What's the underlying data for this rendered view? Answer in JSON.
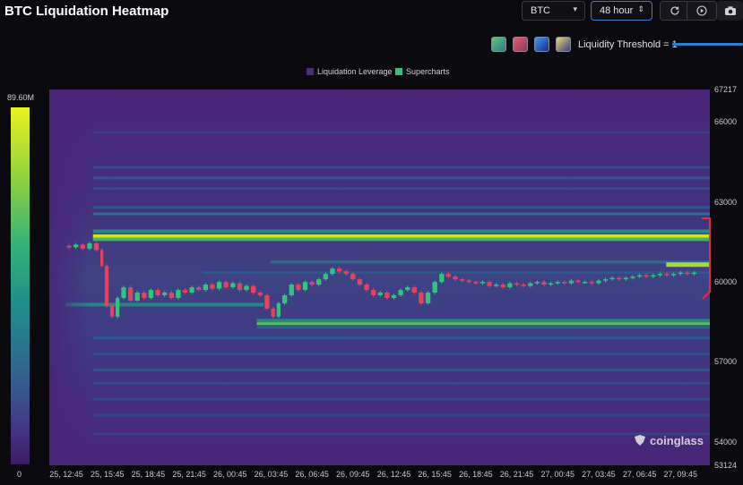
{
  "header": {
    "title": "BTC Liquidation Heatmap",
    "coin_select": "BTC",
    "range_select": "48 hour",
    "threshold_label": "Liquidity Threshold = 1"
  },
  "icons": [
    "refresh-icon",
    "play-icon",
    "camera-icon",
    "chevron-down-icon",
    "up-down-icon"
  ],
  "swatches": [
    {
      "name": "green-theme",
      "from": "#5ac878",
      "to": "#2a7a8a"
    },
    {
      "name": "red-theme",
      "from": "#e06070",
      "to": "#8a3a5a"
    },
    {
      "name": "blue-theme",
      "from": "#3a9af0",
      "to": "#1a2a8a"
    },
    {
      "name": "yellow-theme",
      "from": "#e8d870",
      "to": "#3a3a8a"
    }
  ],
  "colors": {
    "heat_low": "#46227a",
    "heat_mid": "#2a8a8a",
    "heat_high": "#e9f21f",
    "candle_up": "#2fc57b",
    "candle_down": "#e8415d",
    "accent_blue": "#2f7fd0",
    "annotation_red": "#e0303a"
  },
  "colorbar": {
    "max_label": "89.60M",
    "min_label": "0"
  },
  "watermark": "coinglass",
  "chart_data": {
    "type": "heatmap",
    "title": "BTC Liquidation Heatmap",
    "legend": [
      "Liquidation Leverage",
      "Supercharts"
    ],
    "legend_colors": [
      "#4a2a7a",
      "#2fc57b"
    ],
    "legend_placement": "top-center",
    "colorbar_range": [
      0,
      89.6
    ],
    "colorbar_unit": "M",
    "ylim": [
      53124,
      67217
    ],
    "y_ticks": [
      67217,
      66000,
      63000,
      60000,
      57000,
      54000,
      53124
    ],
    "x_ticks": [
      "25, 12:45",
      "25, 15:45",
      "25, 18:45",
      "25, 21:45",
      "26, 00:45",
      "26, 03:45",
      "26, 06:45",
      "26, 09:45",
      "26, 12:45",
      "26, 15:45",
      "26, 18:45",
      "26, 21:45",
      "27, 00:45",
      "27, 03:45",
      "27, 06:45",
      "27, 09:45"
    ],
    "x_tick_hours": [
      0,
      3,
      6,
      9,
      12,
      15,
      18,
      21,
      24,
      27,
      30,
      33,
      36,
      39,
      42,
      45
    ],
    "x_range_hours": [
      -1.2,
      47.2
    ],
    "grid": false,
    "liquidity_bands": [
      {
        "price": 61700,
        "start": 2.0,
        "intensity": 0.97
      },
      {
        "price": 61600,
        "start": 2.0,
        "intensity": 0.7
      },
      {
        "price": 61900,
        "start": 2.0,
        "intensity": 0.55
      },
      {
        "price": 60750,
        "start": 15.0,
        "intensity": 0.45
      },
      {
        "price": 60650,
        "start": 44.0,
        "intensity": 0.9
      },
      {
        "price": 58450,
        "start": 14.0,
        "intensity": 0.75
      },
      {
        "price": 58550,
        "start": 14.0,
        "intensity": 0.55
      },
      {
        "price": 58300,
        "start": 14.0,
        "intensity": 0.4
      },
      {
        "price": 59150,
        "start": 0.0,
        "end": 14.5,
        "intensity": 0.55
      },
      {
        "price": 60350,
        "start": 10.0,
        "intensity": 0.35
      },
      {
        "price": 62550,
        "start": 2.0,
        "intensity": 0.45
      },
      {
        "price": 62800,
        "start": 2.0,
        "intensity": 0.35
      },
      {
        "price": 63500,
        "start": 2.0,
        "intensity": 0.3
      },
      {
        "price": 63900,
        "start": 2.0,
        "intensity": 0.35
      },
      {
        "price": 64300,
        "start": 2.0,
        "intensity": 0.28
      },
      {
        "price": 57900,
        "start": 2.0,
        "intensity": 0.35
      },
      {
        "price": 57300,
        "start": 2.0,
        "intensity": 0.3
      },
      {
        "price": 56700,
        "start": 2.0,
        "intensity": 0.32
      },
      {
        "price": 56200,
        "start": 2.0,
        "intensity": 0.28
      },
      {
        "price": 55600,
        "start": 2.0,
        "intensity": 0.25
      },
      {
        "price": 55000,
        "start": 2.0,
        "intensity": 0.22
      },
      {
        "price": 54300,
        "start": 2.0,
        "intensity": 0.2
      },
      {
        "price": 65600,
        "start": 2.0,
        "intensity": 0.18
      }
    ],
    "price_path": [
      [
        0.0,
        61350
      ],
      [
        0.5,
        61300
      ],
      [
        1.0,
        61400
      ],
      [
        1.5,
        61250
      ],
      [
        2.0,
        61450
      ],
      [
        2.5,
        61200
      ],
      [
        2.8,
        60600
      ],
      [
        3.2,
        59100
      ],
      [
        3.6,
        58700
      ],
      [
        4.0,
        59400
      ],
      [
        4.5,
        59800
      ],
      [
        5.0,
        59300
      ],
      [
        5.5,
        59600
      ],
      [
        6.0,
        59400
      ],
      [
        6.5,
        59700
      ],
      [
        7.0,
        59500
      ],
      [
        7.5,
        59600
      ],
      [
        8.0,
        59400
      ],
      [
        8.5,
        59700
      ],
      [
        9.0,
        59600
      ],
      [
        9.5,
        59800
      ],
      [
        10.0,
        59700
      ],
      [
        10.5,
        59900
      ],
      [
        11.0,
        59750
      ],
      [
        11.5,
        60000
      ],
      [
        12.0,
        59800
      ],
      [
        12.5,
        59950
      ],
      [
        13.0,
        59700
      ],
      [
        13.5,
        59850
      ],
      [
        14.0,
        59600
      ],
      [
        14.5,
        59500
      ],
      [
        15.0,
        59000
      ],
      [
        15.4,
        58700
      ],
      [
        15.8,
        59200
      ],
      [
        16.3,
        59500
      ],
      [
        16.8,
        59900
      ],
      [
        17.3,
        59700
      ],
      [
        17.8,
        60000
      ],
      [
        18.3,
        59900
      ],
      [
        18.8,
        60100
      ],
      [
        19.3,
        60300
      ],
      [
        19.8,
        60500
      ],
      [
        20.3,
        60400
      ],
      [
        20.8,
        60300
      ],
      [
        21.3,
        60100
      ],
      [
        21.8,
        59900
      ],
      [
        22.3,
        59700
      ],
      [
        22.8,
        59500
      ],
      [
        23.3,
        59600
      ],
      [
        23.8,
        59400
      ],
      [
        24.3,
        59500
      ],
      [
        24.8,
        59700
      ],
      [
        25.3,
        59800
      ],
      [
        25.8,
        59600
      ],
      [
        26.3,
        59200
      ],
      [
        26.8,
        59600
      ],
      [
        27.3,
        60000
      ],
      [
        27.8,
        60300
      ],
      [
        28.3,
        60200
      ],
      [
        28.8,
        60100
      ],
      [
        29.3,
        60050
      ],
      [
        29.8,
        60000
      ],
      [
        30.3,
        59950
      ],
      [
        30.8,
        60000
      ],
      [
        31.3,
        59850
      ],
      [
        31.8,
        59900
      ],
      [
        32.3,
        59800
      ],
      [
        32.8,
        59950
      ],
      [
        33.3,
        59900
      ],
      [
        33.8,
        59850
      ],
      [
        34.3,
        59950
      ],
      [
        34.8,
        60000
      ],
      [
        35.3,
        59900
      ],
      [
        35.8,
        59950
      ],
      [
        36.3,
        60000
      ],
      [
        36.8,
        59950
      ],
      [
        37.3,
        60050
      ],
      [
        37.8,
        60000
      ],
      [
        38.3,
        60000
      ],
      [
        38.8,
        59950
      ],
      [
        39.3,
        60050
      ],
      [
        39.8,
        60100
      ],
      [
        40.3,
        60150
      ],
      [
        40.8,
        60100
      ],
      [
        41.3,
        60150
      ],
      [
        41.8,
        60200
      ],
      [
        42.3,
        60250
      ],
      [
        42.8,
        60200
      ],
      [
        43.3,
        60250
      ],
      [
        43.8,
        60300
      ],
      [
        44.3,
        60250
      ],
      [
        44.8,
        60300
      ],
      [
        45.3,
        60350
      ],
      [
        45.8,
        60300
      ],
      [
        46.3,
        60350
      ]
    ]
  }
}
